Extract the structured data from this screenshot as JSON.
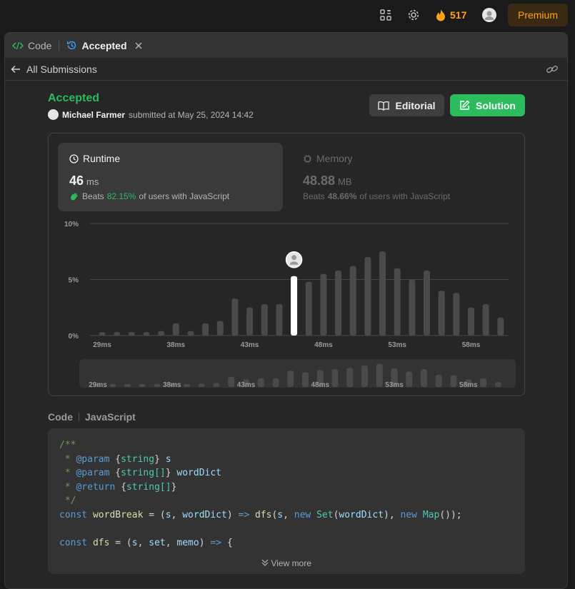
{
  "topbar": {
    "streak_count": "517",
    "premium_label": "Premium"
  },
  "tabs": [
    {
      "label": "Code",
      "active": false
    },
    {
      "label": "Accepted",
      "active": true
    }
  ],
  "subbar": {
    "back_label": "All Submissions"
  },
  "submission": {
    "status": "Accepted",
    "user": "Michael Farmer",
    "submitted_text": "submitted at May 25, 2024 14:42",
    "editorial_label": "Editorial",
    "solution_label": "Solution"
  },
  "runtime": {
    "label": "Runtime",
    "value": "46",
    "unit": "ms",
    "beats_prefix": "Beats",
    "beats_pct": "82.15%",
    "beats_suffix": "of users with JavaScript"
  },
  "memory": {
    "label": "Memory",
    "value": "48.88",
    "unit": "MB",
    "beats_prefix": "Beats",
    "beats_pct": "48.66%",
    "beats_suffix": "of users with JavaScript"
  },
  "colors": {
    "accent_green": "#2cbb5d",
    "orange": "#ffa116",
    "bar": "#4a4a4a",
    "highlight_bar": "#ffffff"
  },
  "chart_data": {
    "type": "bar",
    "yticks": [
      "0%",
      "5%",
      "10%"
    ],
    "ylim": [
      0,
      10
    ],
    "xticks": [
      "29ms",
      "38ms",
      "43ms",
      "48ms",
      "53ms",
      "58ms"
    ],
    "values": [
      0.3,
      0.3,
      0.3,
      0.3,
      0.4,
      1.1,
      0.4,
      1.1,
      1.3,
      3.3,
      2.5,
      2.8,
      2.8,
      5.3,
      4.8,
      5.5,
      5.8,
      6.2,
      7.0,
      7.5,
      6.0,
      5.0,
      5.8,
      4.0,
      3.8,
      2.5,
      2.8,
      1.6
    ],
    "highlight_index": 13,
    "overview_values": [
      0.3,
      0.3,
      0.3,
      0.3,
      0.4,
      1.1,
      0.4,
      1.1,
      1.3,
      3.3,
      2.5,
      2.8,
      2.8,
      5.3,
      4.8,
      5.5,
      5.8,
      6.2,
      7.0,
      7.5,
      6.0,
      5.0,
      5.8,
      4.0,
      3.8,
      2.5,
      2.8,
      1.6
    ]
  },
  "code": {
    "header_label": "Code",
    "language": "JavaScript",
    "view_more_label": "View more"
  }
}
